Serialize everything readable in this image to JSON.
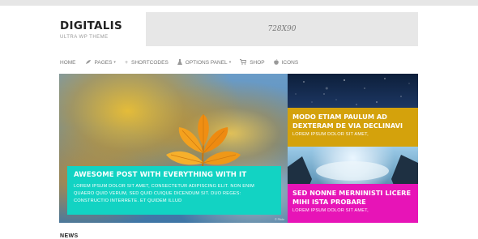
{
  "site": {
    "title": "DIGITALIS",
    "tagline": "ULTRA WP THEME"
  },
  "ad": {
    "label": "728X90"
  },
  "nav": {
    "items": [
      {
        "label": "HOME",
        "icon": ""
      },
      {
        "label": "PAGES",
        "icon": "feather-icon",
        "dropdown": true
      },
      {
        "label": "SHORTCODES",
        "icon": "plus-icon"
      },
      {
        "label": "OPTIONS PANEL",
        "icon": "flask-icon",
        "dropdown": true
      },
      {
        "label": "SHOP",
        "icon": "cart-icon"
      },
      {
        "label": "ICONS",
        "icon": "apple-icon"
      }
    ]
  },
  "slider": {
    "main": {
      "title": "AWESOME POST WITH EVERYTHING WITH IT",
      "excerpt": "LOREM IPSUM DOLOR SIT AMET, CONSECTETUR ADIPISCING ELIT. NON ENIM QUAERO QUID VERUM, SED QUID CUIQUE DICENDUM SIT. DUO REGES: CONSTRUCTIO INTERRETE. ET QUIDEM ILLUD",
      "caption_color": "#12d3c3"
    },
    "side1": {
      "title": "MODO ETIAM PAULUM AD DEXTERAM DE VIA DECLINAVI",
      "excerpt": "LOREM IPSUM DOLOR SIT AMET,",
      "caption_color": "#d4a20c"
    },
    "side2": {
      "title": "SED NONNE MERNINISTI LICERE MIHI ISTA PROBARE",
      "excerpt": "LOREM IPSUM DOLOR SIT AMET,",
      "caption_color": "#e714b7"
    }
  },
  "news": {
    "heading": "NEWS"
  }
}
